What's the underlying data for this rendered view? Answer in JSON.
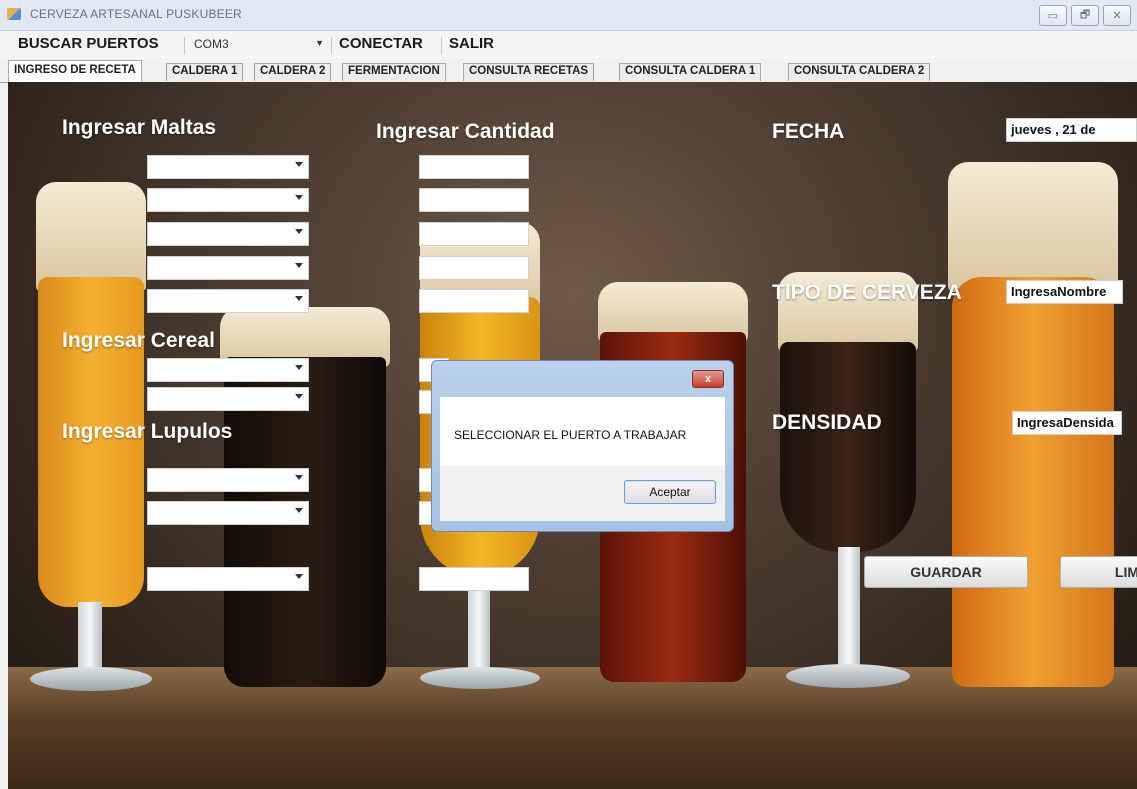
{
  "window": {
    "title": "CERVEZA ARTESANAL PUSKUBEER",
    "controls": [
      "▭",
      "🗗",
      "✕"
    ]
  },
  "menu": {
    "buscar": "BUSCAR PUERTOS",
    "port_value": "COM3",
    "conectar": "CONECTAR",
    "salir": "SALIR"
  },
  "tabs": [
    "INGRESO DE RECETA",
    "CALDERA 1",
    "CALDERA 2",
    "FERMENTACION",
    "CONSULTA RECETAS",
    "CONSULTA CALDERA 1",
    "CONSULTA CALDERA 2"
  ],
  "form": {
    "maltas_label": "Ingresar Maltas",
    "cantidad_label": "Ingresar Cantidad",
    "cereal_label": "Ingresar Cereal",
    "lupulos_label": "Ingresar Lupulos",
    "fecha_label": "FECHA",
    "fecha_value": "jueves   , 21 de",
    "tipo_label": "TIPO DE CERVEZA",
    "tipo_value": "IngresaNombre",
    "densidad_label": "DENSIDAD",
    "densidad_value": "IngresaDensida",
    "guardar": "GUARDAR",
    "limpiar": "LIM"
  },
  "dialog": {
    "message": "SELECCIONAR EL PUERTO A TRABAJAR",
    "ok": "Aceptar",
    "close": "x"
  },
  "colors": {
    "titlebar": "#dfe8f3",
    "label": "#ffffff",
    "dialog_frame": "#a6c2e2",
    "close_red": "#c2412c"
  }
}
